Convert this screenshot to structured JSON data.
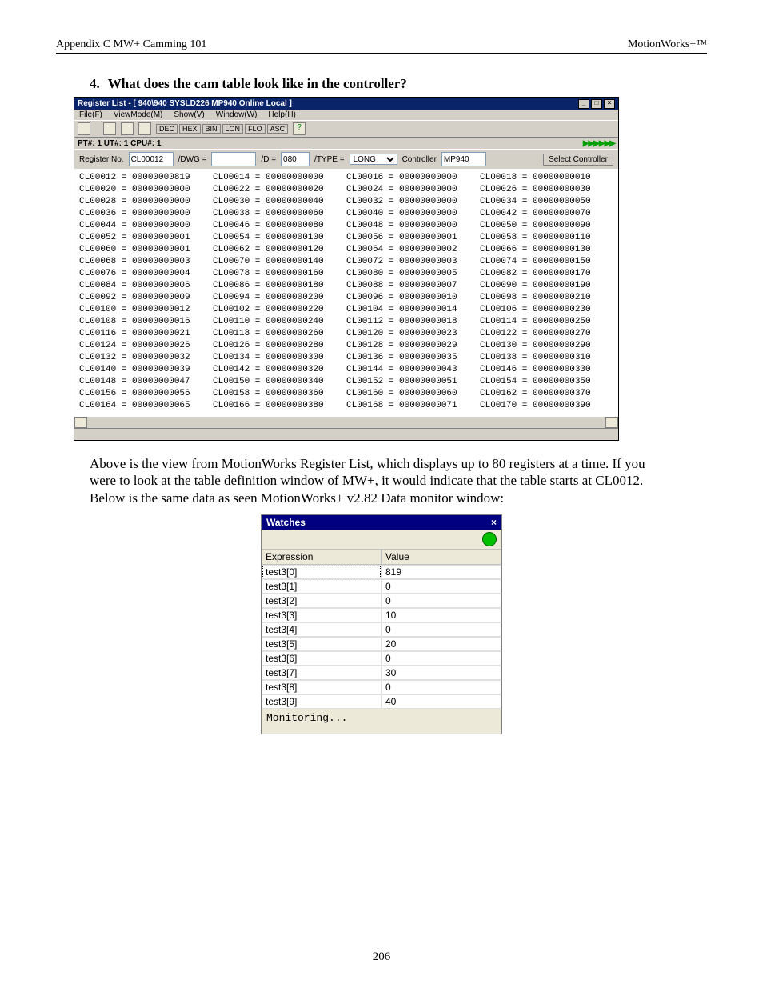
{
  "header": {
    "left": "Appendix C MW+ Camming 101",
    "right": "MotionWorks+™"
  },
  "section": {
    "num": "4.",
    "title": "What does the cam table look like in the controller?"
  },
  "regwin": {
    "title": "Register List - [   940\\940 SYSLD226 MP940   Online Local ]",
    "menus": [
      "File(F)",
      "ViewMode(M)",
      "Show(V)",
      "Window(W)",
      "Help(H)"
    ],
    "toolbar_labels": [
      "DEC",
      "HEX",
      "BIN",
      "LON",
      "FLO",
      "ASC"
    ],
    "status": "PT#: 1 UT#: 1 CPU#: 1",
    "filter": {
      "regno_label": "Register No.",
      "regno_value": "CL00012",
      "dwg_label": "/DWG =",
      "dwg_value": "",
      "d_label": "/D =",
      "d_value": "080",
      "type_label": "/TYPE =",
      "type_value": "LONG",
      "controller_label": "Controller",
      "controller_value": "MP940",
      "select_btn": "Select Controller"
    },
    "rows": [
      [
        [
          "CL00012",
          "00000000819"
        ],
        [
          "CL00014",
          "00000000000"
        ],
        [
          "CL00016",
          "00000000000"
        ],
        [
          "CL00018",
          "00000000010"
        ]
      ],
      [
        [
          "CL00020",
          "00000000000"
        ],
        [
          "CL00022",
          "00000000020"
        ],
        [
          "CL00024",
          "00000000000"
        ],
        [
          "CL00026",
          "00000000030"
        ]
      ],
      [
        [
          "CL00028",
          "00000000000"
        ],
        [
          "CL00030",
          "00000000040"
        ],
        [
          "CL00032",
          "00000000000"
        ],
        [
          "CL00034",
          "00000000050"
        ]
      ],
      [
        [
          "CL00036",
          "00000000000"
        ],
        [
          "CL00038",
          "00000000060"
        ],
        [
          "CL00040",
          "00000000000"
        ],
        [
          "CL00042",
          "00000000070"
        ]
      ],
      [
        [
          "CL00044",
          "00000000000"
        ],
        [
          "CL00046",
          "00000000080"
        ],
        [
          "CL00048",
          "00000000000"
        ],
        [
          "CL00050",
          "00000000090"
        ]
      ],
      [
        [
          "CL00052",
          "00000000001"
        ],
        [
          "CL00054",
          "00000000100"
        ],
        [
          "CL00056",
          "00000000001"
        ],
        [
          "CL00058",
          "00000000110"
        ]
      ],
      [
        [
          "CL00060",
          "00000000001"
        ],
        [
          "CL00062",
          "00000000120"
        ],
        [
          "CL00064",
          "00000000002"
        ],
        [
          "CL00066",
          "00000000130"
        ]
      ],
      [
        [
          "CL00068",
          "00000000003"
        ],
        [
          "CL00070",
          "00000000140"
        ],
        [
          "CL00072",
          "00000000003"
        ],
        [
          "CL00074",
          "00000000150"
        ]
      ],
      [
        [
          "CL00076",
          "00000000004"
        ],
        [
          "CL00078",
          "00000000160"
        ],
        [
          "CL00080",
          "00000000005"
        ],
        [
          "CL00082",
          "00000000170"
        ]
      ],
      [
        [
          "CL00084",
          "00000000006"
        ],
        [
          "CL00086",
          "00000000180"
        ],
        [
          "CL00088",
          "00000000007"
        ],
        [
          "CL00090",
          "00000000190"
        ]
      ],
      [
        [
          "CL00092",
          "00000000009"
        ],
        [
          "CL00094",
          "00000000200"
        ],
        [
          "CL00096",
          "00000000010"
        ],
        [
          "CL00098",
          "00000000210"
        ]
      ],
      [
        [
          "CL00100",
          "00000000012"
        ],
        [
          "CL00102",
          "00000000220"
        ],
        [
          "CL00104",
          "00000000014"
        ],
        [
          "CL00106",
          "00000000230"
        ]
      ],
      [
        [
          "CL00108",
          "00000000016"
        ],
        [
          "CL00110",
          "00000000240"
        ],
        [
          "CL00112",
          "00000000018"
        ],
        [
          "CL00114",
          "00000000250"
        ]
      ],
      [
        [
          "CL00116",
          "00000000021"
        ],
        [
          "CL00118",
          "00000000260"
        ],
        [
          "CL00120",
          "00000000023"
        ],
        [
          "CL00122",
          "00000000270"
        ]
      ],
      [
        [
          "CL00124",
          "00000000026"
        ],
        [
          "CL00126",
          "00000000280"
        ],
        [
          "CL00128",
          "00000000029"
        ],
        [
          "CL00130",
          "00000000290"
        ]
      ],
      [
        [
          "CL00132",
          "00000000032"
        ],
        [
          "CL00134",
          "00000000300"
        ],
        [
          "CL00136",
          "00000000035"
        ],
        [
          "CL00138",
          "00000000310"
        ]
      ],
      [
        [
          "CL00140",
          "00000000039"
        ],
        [
          "CL00142",
          "00000000320"
        ],
        [
          "CL00144",
          "00000000043"
        ],
        [
          "CL00146",
          "00000000330"
        ]
      ],
      [
        [
          "CL00148",
          "00000000047"
        ],
        [
          "CL00150",
          "00000000340"
        ],
        [
          "CL00152",
          "00000000051"
        ],
        [
          "CL00154",
          "00000000350"
        ]
      ],
      [
        [
          "CL00156",
          "00000000056"
        ],
        [
          "CL00158",
          "00000000360"
        ],
        [
          "CL00160",
          "00000000060"
        ],
        [
          "CL00162",
          "00000000370"
        ]
      ],
      [
        [
          "CL00164",
          "00000000065"
        ],
        [
          "CL00166",
          "00000000380"
        ],
        [
          "CL00168",
          "00000000071"
        ],
        [
          "CL00170",
          "00000000390"
        ]
      ]
    ]
  },
  "bodytext": "Above is the view from MotionWorks Register List, which displays up to 80 registers at a time.  If you were to look at the table definition window of MW+, it would indicate that the table starts at CL0012.  Below is the same data as seen MotionWorks+ v2.82 Data monitor window:",
  "watches": {
    "title": "Watches",
    "headers": [
      "Expression",
      "Value"
    ],
    "rows": [
      [
        "test3[0]",
        "819"
      ],
      [
        "test3[1]",
        "0"
      ],
      [
        "test3[2]",
        "0"
      ],
      [
        "test3[3]",
        "10"
      ],
      [
        "test3[4]",
        "0"
      ],
      [
        "test3[5]",
        "20"
      ],
      [
        "test3[6]",
        "0"
      ],
      [
        "test3[7]",
        "30"
      ],
      [
        "test3[8]",
        "0"
      ],
      [
        "test3[9]",
        "40"
      ]
    ],
    "status": "Monitoring..."
  },
  "pagenum": "206"
}
